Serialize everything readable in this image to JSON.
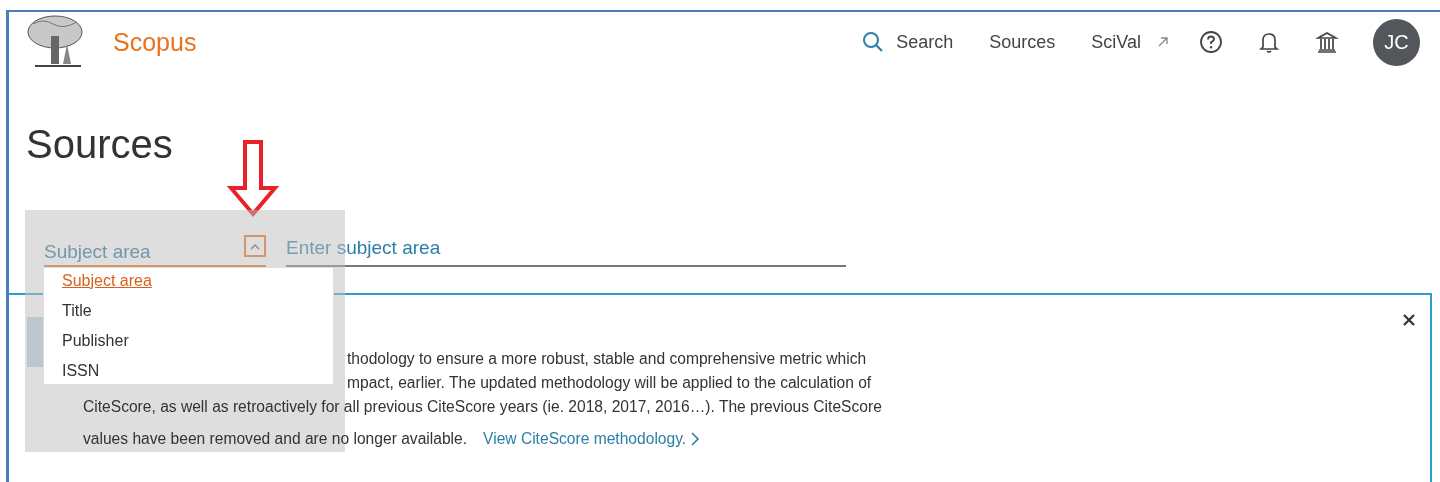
{
  "header": {
    "brand": "Scopus",
    "nav": [
      {
        "kind": "search",
        "label": "Search"
      },
      {
        "kind": "link",
        "label": "Sources"
      },
      {
        "kind": "external",
        "label": "SciVal"
      }
    ],
    "avatar": "JC"
  },
  "page_title": "Sources",
  "search": {
    "field_label": "Subject area",
    "expanded": true,
    "placeholder": "Enter subject area",
    "options": [
      {
        "label": "Subject area",
        "selected": true
      },
      {
        "label": "Title",
        "selected": false
      },
      {
        "label": "Publisher",
        "selected": false
      },
      {
        "label": "ISSN",
        "selected": false
      }
    ]
  },
  "notice": {
    "lines": [
      {
        "kind": "partial",
        "text": "thodology to ensure a more robust, stable and comprehensive metric which"
      },
      {
        "kind": "partial",
        "text": "mpact, earlier. The updated methodology will be applied to the calculation of"
      },
      {
        "kind": "full",
        "text": "CiteScore, as well as retroactively for all previous CiteScore years (ie. 2018, 2017, 2016…). The previous CiteScore"
      },
      {
        "kind": "full",
        "text": "values have been removed and are no longer available."
      }
    ],
    "link": "View CiteScore methodology."
  }
}
